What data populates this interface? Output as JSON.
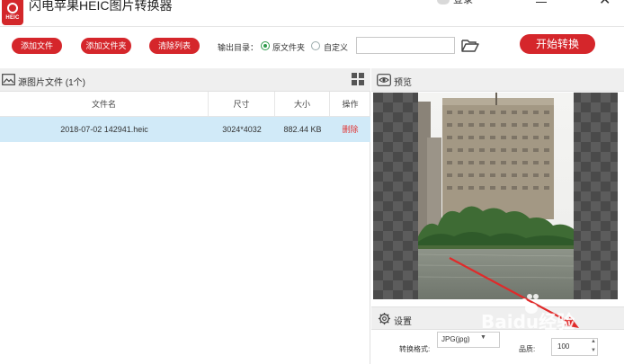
{
  "window": {
    "title": "闪电苹果HEIC图片转换器",
    "logo_text": "HEIC",
    "account_text": "登录"
  },
  "toolbar": {
    "add_file": "添加文件",
    "add_folder": "添加文件夹",
    "clear_list": "清除列表",
    "output_label": "输出目录：",
    "option_original": "原文件夹",
    "option_custom": "自定义",
    "path_value": "",
    "start": "开始转换"
  },
  "file_panel": {
    "title": "源图片文件 (1个)",
    "columns": [
      "文件名",
      "尺寸",
      "大小",
      "操作"
    ],
    "rows": [
      {
        "name": "2018-07-02 142941.heic",
        "dimensions": "3024*4032",
        "size": "882.44 KB",
        "action": "删除"
      }
    ]
  },
  "preview": {
    "title": "预览"
  },
  "settings": {
    "title": "设置",
    "format_label": "转换格式:",
    "format_value": "JPG(jpg)",
    "quality_label": "品质:",
    "quality_value": "100"
  },
  "watermark": {
    "text": "Baidu经验"
  },
  "colors": {
    "accent_red": "#d5262b",
    "selected_row": "#d1eaf8",
    "radio_green": "#2e9b4a",
    "delete_red": "#e03636"
  },
  "icons": [
    "logo-icon",
    "user-icon",
    "minimize-icon",
    "close-icon",
    "folder-open-icon",
    "image-icon",
    "grid-view-icon",
    "eye-icon",
    "gear-icon",
    "dropdown-arrow-icon",
    "stepper-up-icon",
    "stepper-down-icon"
  ]
}
